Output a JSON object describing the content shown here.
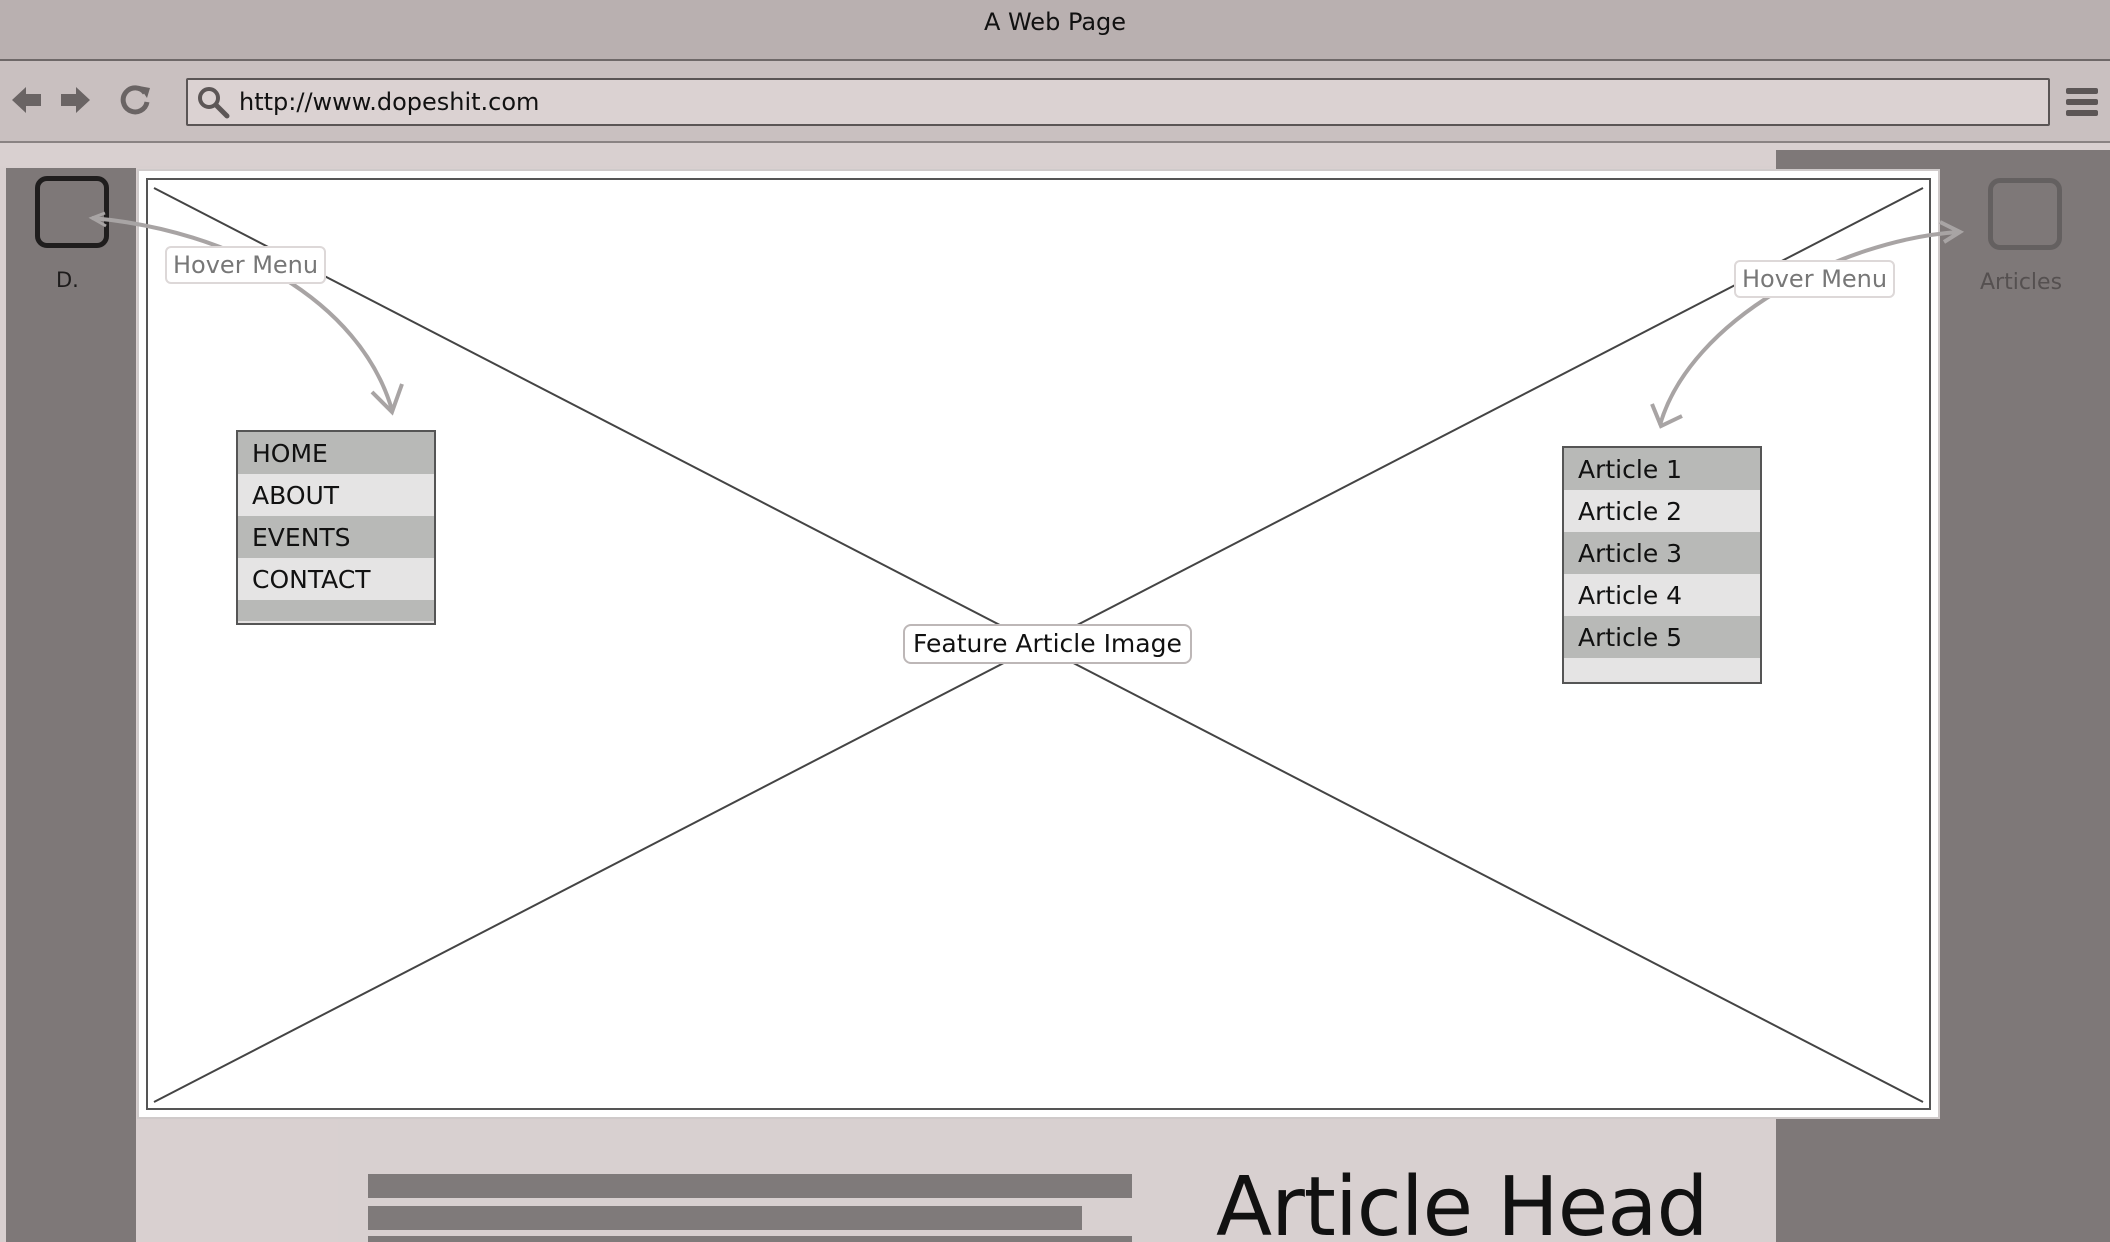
{
  "window": {
    "title": "A Web Page"
  },
  "browser": {
    "url": "http://www.dopeshit.com",
    "icons": [
      "back-arrow-icon",
      "forward-arrow-icon",
      "reload-icon",
      "search-icon",
      "hamburger-menu-icon"
    ]
  },
  "left_column": {
    "logo_label": "D."
  },
  "right_column": {
    "articles_label": "Articles"
  },
  "feature": {
    "label": "Feature Article Image"
  },
  "annotations": {
    "left_hover": "Hover Menu",
    "right_hover": "Hover Menu"
  },
  "left_menu": {
    "items": [
      "HOME",
      "ABOUT",
      "EVENTS",
      "CONTACT"
    ]
  },
  "right_menu": {
    "items": [
      "Article 1",
      "Article 2",
      "Article 3",
      "Article 4",
      "Article 5"
    ]
  },
  "content": {
    "headline": "Article Head"
  },
  "colors": {
    "chrome": "#b9b0b0",
    "sidebar": "#7e7878",
    "menu_dark": "#b8b9b7",
    "menu_light": "#e5e4e4"
  }
}
